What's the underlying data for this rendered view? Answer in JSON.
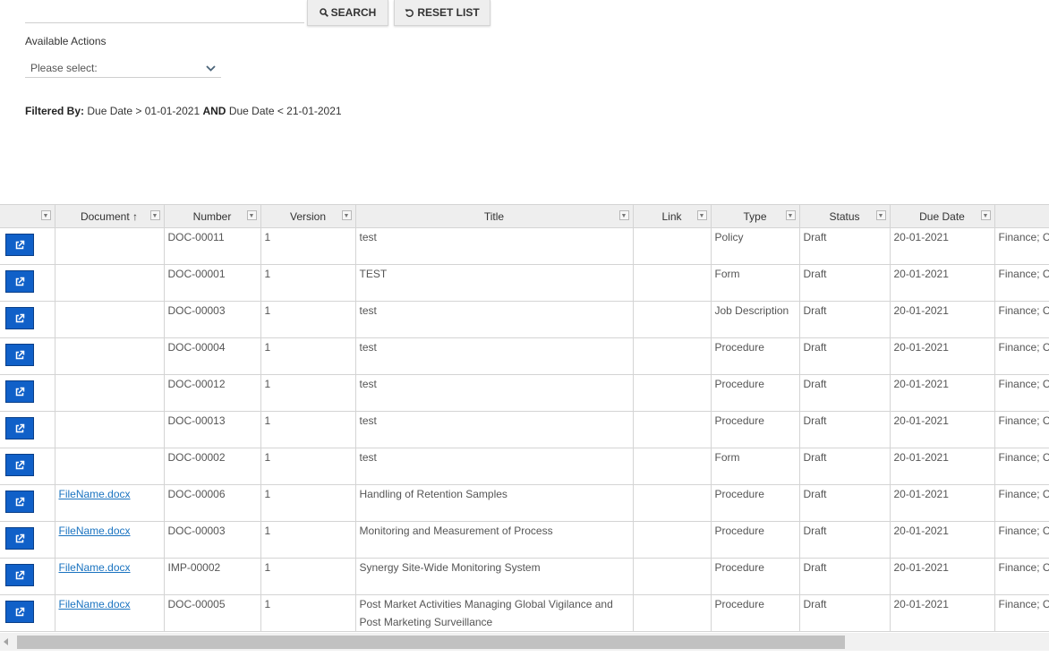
{
  "toolbar": {
    "search_label": "SEARCH",
    "reset_label": "RESET LIST"
  },
  "actions": {
    "label": "Available Actions",
    "select_value": "Please select:"
  },
  "filter": {
    "prefix": "Filtered By:",
    "part1": "Due Date > 01-01-2021",
    "and": "AND",
    "part2": "Due Date < 21-01-2021"
  },
  "table": {
    "headers": {
      "document": "Document",
      "document_sort": "↑",
      "number": "Number",
      "version": "Version",
      "title": "Title",
      "link": "Link",
      "type": "Type",
      "status": "Status",
      "due_date": "Due Date"
    },
    "rows": [
      {
        "document": "",
        "number": "DOC-00011",
        "version": "1",
        "title": "test",
        "link": "",
        "type": "Policy",
        "status": "Draft",
        "due_date": "20-01-2021",
        "extra": "Finance; C"
      },
      {
        "document": "",
        "number": "DOC-00001",
        "version": "1",
        "title": "TEST",
        "link": "",
        "type": "Form",
        "status": "Draft",
        "due_date": "20-01-2021",
        "extra": "Finance; C"
      },
      {
        "document": "",
        "number": "DOC-00003",
        "version": "1",
        "title": "test",
        "link": "",
        "type": "Job Description",
        "status": "Draft",
        "due_date": "20-01-2021",
        "extra": "Finance; C"
      },
      {
        "document": "",
        "number": "DOC-00004",
        "version": "1",
        "title": "test",
        "link": "",
        "type": "Procedure",
        "status": "Draft",
        "due_date": "20-01-2021",
        "extra": "Finance; C"
      },
      {
        "document": "",
        "number": "DOC-00012",
        "version": "1",
        "title": "test",
        "link": "",
        "type": "Procedure",
        "status": "Draft",
        "due_date": "20-01-2021",
        "extra": "Finance; C"
      },
      {
        "document": "",
        "number": "DOC-00013",
        "version": "1",
        "title": "test",
        "link": "",
        "type": "Procedure",
        "status": "Draft",
        "due_date": "20-01-2021",
        "extra": "Finance; C"
      },
      {
        "document": "",
        "number": "DOC-00002",
        "version": "1",
        "title": "test",
        "link": "",
        "type": "Form",
        "status": "Draft",
        "due_date": "20-01-2021",
        "extra": "Finance; C"
      },
      {
        "document": "FileName.docx",
        "number": "DOC-00006",
        "version": "1",
        "title": "Handling of Retention Samples",
        "link": "",
        "type": "Procedure",
        "status": "Draft",
        "due_date": "20-01-2021",
        "extra": "Finance; C"
      },
      {
        "document": "FileName.docx",
        "number": "DOC-00003",
        "version": "1",
        "title": "Monitoring and Measurement of Process",
        "link": "",
        "type": "Procedure",
        "status": "Draft",
        "due_date": "20-01-2021",
        "extra": "Finance; C"
      },
      {
        "document": "FileName.docx",
        "number": "IMP-00002",
        "version": "1",
        "title": "Synergy Site-Wide Monitoring System",
        "link": "",
        "type": "Procedure",
        "status": "Draft",
        "due_date": "20-01-2021",
        "extra": "Finance; C"
      },
      {
        "document": "FileName.docx",
        "number": "DOC-00005",
        "version": "1",
        "title": "Post Market Activities Managing Global Vigilance and Post Marketing Surveillance",
        "link": "",
        "type": "Procedure",
        "status": "Draft",
        "due_date": "20-01-2021",
        "extra": "Finance; C"
      }
    ]
  }
}
